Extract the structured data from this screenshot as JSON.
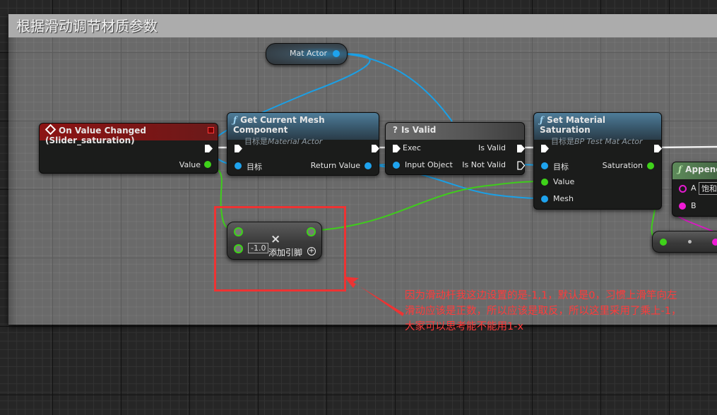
{
  "comment": {
    "title": "根据滑动调节材质参数"
  },
  "variable_node": {
    "label": "Mat Actor"
  },
  "event_node": {
    "title": "On Value Changed (Slider_saturation)",
    "output_label": "Value"
  },
  "get_mesh_node": {
    "title": "Get Current Mesh Component",
    "subtitle_prefix": "目标是",
    "subtitle_target": "Material Actor",
    "input_label": "目标",
    "output_label": "Return Value"
  },
  "is_valid_node": {
    "title": "Is Valid",
    "exec_label": "Exec",
    "input_label": "Input Object",
    "valid_label": "Is Valid",
    "not_valid_label": "Is Not Valid"
  },
  "set_saturation_node": {
    "title": "Set Material Saturation",
    "subtitle_prefix": "目标是",
    "subtitle_target": "BP Test Mat Actor",
    "target_label": "目标",
    "value_label": "Value",
    "mesh_label": "Mesh",
    "output_label": "Saturation"
  },
  "append_node": {
    "title": "Append",
    "a_label": "A",
    "a_value": "饱和",
    "b_label": "B"
  },
  "multiply_node": {
    "symbol": "×",
    "constant_value": "-1.0",
    "add_pin_label": "添加引脚"
  },
  "annotation": {
    "lines": [
      "因为滑动杆我这边设置的是-1,1，默认是0，习惯上滑竿向左",
      "滑动应该是正数，所以应该是取反，所以这里采用了乘上-1，",
      "大家可以思考能不能用1-x"
    ]
  },
  "colors": {
    "object_pin": "#1ea3ee",
    "float_pin": "#3fd21a",
    "string_pin": "#f01ad6",
    "exec_wire": "#ffffff",
    "annotation": "#ff3b3b"
  }
}
